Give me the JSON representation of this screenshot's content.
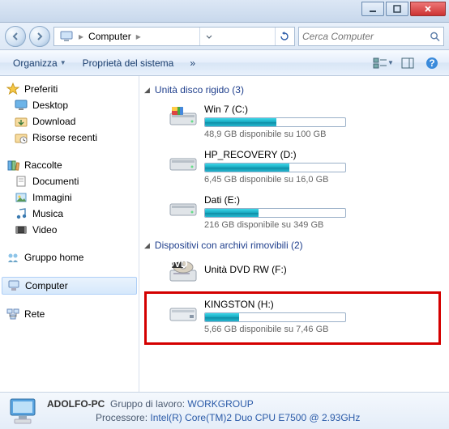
{
  "titlebar": {
    "min": "min",
    "max": "max",
    "close": "close"
  },
  "nav": {
    "location": "Computer",
    "search_placeholder": "Cerca Computer"
  },
  "toolbar": {
    "organize": "Organizza",
    "sysprops": "Proprietà del sistema",
    "more": "»"
  },
  "sidebar": {
    "favorites": {
      "label": "Preferiti",
      "items": [
        "Desktop",
        "Download",
        "Risorse recenti"
      ]
    },
    "libraries": {
      "label": "Raccolte",
      "items": [
        "Documenti",
        "Immagini",
        "Musica",
        "Video"
      ]
    },
    "homegroup": {
      "label": "Gruppo home"
    },
    "computer": {
      "label": "Computer"
    },
    "network": {
      "label": "Rete"
    }
  },
  "content": {
    "hdd_header": "Unità disco rigido (3)",
    "removable_header": "Dispositivi con archivi rimovibili (2)",
    "drives": [
      {
        "name": "Win 7 (C:)",
        "sub": "48,9 GB disponibile su 100 GB",
        "fill": 51,
        "bar": true
      },
      {
        "name": "HP_RECOVERY (D:)",
        "sub": "6,45 GB disponibile su 16,0 GB",
        "fill": 60,
        "bar": true
      },
      {
        "name": "Dati (E:)",
        "sub": "216 GB disponibile su 349 GB",
        "fill": 38,
        "bar": true
      }
    ],
    "dvd": {
      "name": "Unità DVD RW (F:)"
    },
    "usb": {
      "name": "KINGSTON (H:)",
      "sub": "5,66 GB disponibile su 7,46 GB",
      "fill": 24
    }
  },
  "status": {
    "pcname": "ADOLFO-PC",
    "wg_label": "Gruppo di lavoro:",
    "wg_value": "WORKGROUP",
    "cpu_label": "Processore:",
    "cpu_value": "Intel(R) Core(TM)2 Duo CPU     E7500  @ 2.93GHz"
  }
}
